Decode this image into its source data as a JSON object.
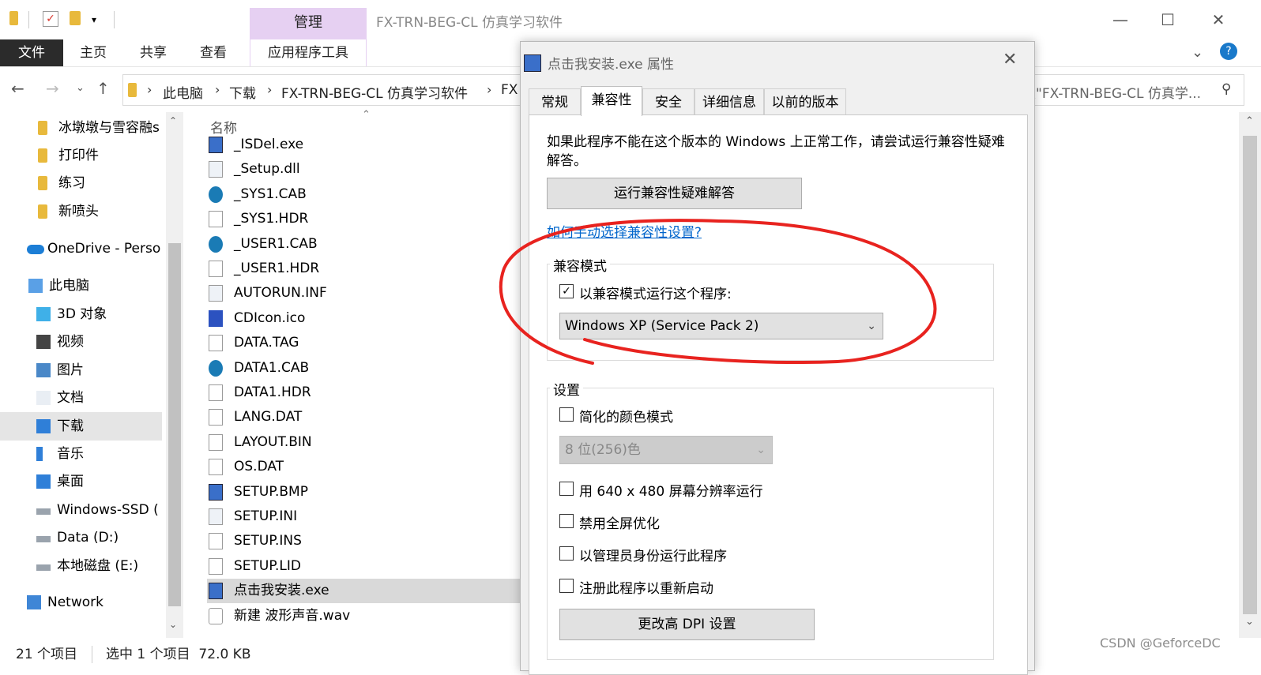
{
  "window": {
    "title": "FX-TRN-BEG-CL 仿真学习软件",
    "manage_tab": "管理",
    "minimize": "—",
    "maximize": "☐",
    "close": "✕"
  },
  "ribbon": {
    "tabs": [
      "文件",
      "主页",
      "共享",
      "查看",
      "应用程序工具"
    ]
  },
  "address": {
    "crumbs": [
      "此电脑",
      "下载",
      "FX-TRN-BEG-CL 仿真学习软件",
      "FX"
    ],
    "search_text": "搜\"FX-TRN-BEG-CL 仿真学..."
  },
  "navpane": {
    "items": [
      {
        "label": "冰墩墩与雪容融s",
        "icon": "folder-icon"
      },
      {
        "label": "打印件",
        "icon": "folder-icon"
      },
      {
        "label": "练习",
        "icon": "folder-icon"
      },
      {
        "label": "新喷头",
        "icon": "folder-icon"
      },
      {
        "label": "OneDrive - Perso",
        "icon": "cloud-icon"
      },
      {
        "label": "此电脑",
        "icon": "pc-icon"
      },
      {
        "label": "3D 对象",
        "icon": "cube-icon"
      },
      {
        "label": "视频",
        "icon": "video-icon"
      },
      {
        "label": "图片",
        "icon": "picture-icon"
      },
      {
        "label": "文档",
        "icon": "document-icon"
      },
      {
        "label": "下载",
        "icon": "download-icon"
      },
      {
        "label": "音乐",
        "icon": "music-icon"
      },
      {
        "label": "桌面",
        "icon": "desktop-icon"
      },
      {
        "label": "Windows-SSD (",
        "icon": "drive-icon"
      },
      {
        "label": "Data (D:)",
        "icon": "drive-icon"
      },
      {
        "label": "本地磁盘 (E:)",
        "icon": "drive-icon"
      },
      {
        "label": "Network",
        "icon": "network-icon"
      }
    ]
  },
  "filelist": {
    "column_name": "名称",
    "files": [
      {
        "name": "_ISDel.exe",
        "icon": "exe-icon"
      },
      {
        "name": "_Setup.dll",
        "icon": "dll-icon"
      },
      {
        "name": "_SYS1.CAB",
        "icon": "cab-icon"
      },
      {
        "name": "_SYS1.HDR",
        "icon": "file-icon"
      },
      {
        "name": "_USER1.CAB",
        "icon": "cab-icon"
      },
      {
        "name": "_USER1.HDR",
        "icon": "file-icon"
      },
      {
        "name": "AUTORUN.INF",
        "icon": "settings-file-icon"
      },
      {
        "name": "CDIcon.ico",
        "icon": "fx-icon"
      },
      {
        "name": "DATA.TAG",
        "icon": "file-icon"
      },
      {
        "name": "DATA1.CAB",
        "icon": "cab-icon"
      },
      {
        "name": "DATA1.HDR",
        "icon": "file-icon"
      },
      {
        "name": "LANG.DAT",
        "icon": "file-icon"
      },
      {
        "name": "LAYOUT.BIN",
        "icon": "file-icon"
      },
      {
        "name": "OS.DAT",
        "icon": "file-icon"
      },
      {
        "name": "SETUP.BMP",
        "icon": "image-file-icon"
      },
      {
        "name": "SETUP.INI",
        "icon": "settings-file-icon"
      },
      {
        "name": "SETUP.INS",
        "icon": "file-icon"
      },
      {
        "name": "SETUP.LID",
        "icon": "file-icon"
      },
      {
        "name": "点击我安装.exe",
        "icon": "installer-icon"
      },
      {
        "name": "新建 波形声音.wav",
        "icon": "audio-file-icon"
      }
    ]
  },
  "status": {
    "items_count": "21 个项目",
    "selected": "选中 1 个项目  72.0 KB"
  },
  "dialog": {
    "title": "点击我安装.exe 属性",
    "tabs": [
      "常规",
      "兼容性",
      "安全",
      "详细信息",
      "以前的版本"
    ],
    "intro": "如果此程序不能在这个版本的 Windows 上正常工作，请尝试运行兼容性疑难解答。",
    "troubleshoot_button": "运行兼容性疑难解答",
    "manual_link": "如何手动选择兼容性设置?",
    "compat_group_title": "兼容模式",
    "compat_checkbox_label": "以兼容模式运行这个程序:",
    "compat_checked": true,
    "compat_os_value": "Windows XP (Service Pack 2)",
    "settings_group_title": "设置",
    "reduced_color_label": "简化的颜色模式",
    "color_depth_value": "8 位(256)色",
    "res_640_label": "用 640 x 480 屏幕分辨率运行",
    "disable_fullscreen_label": "禁用全屏优化",
    "run_as_admin_label": "以管理员身份运行此程序",
    "register_restart_label": "注册此程序以重新启动",
    "dpi_button": "更改高 DPI 设置"
  },
  "watermark": "CSDN @GeforceDC",
  "colors": {
    "file_tab_bg": "#2b2b2b",
    "manage_tab_bg": "#e6d0f2",
    "annotation_red": "#e8231f",
    "link_blue": "#0066cc"
  }
}
